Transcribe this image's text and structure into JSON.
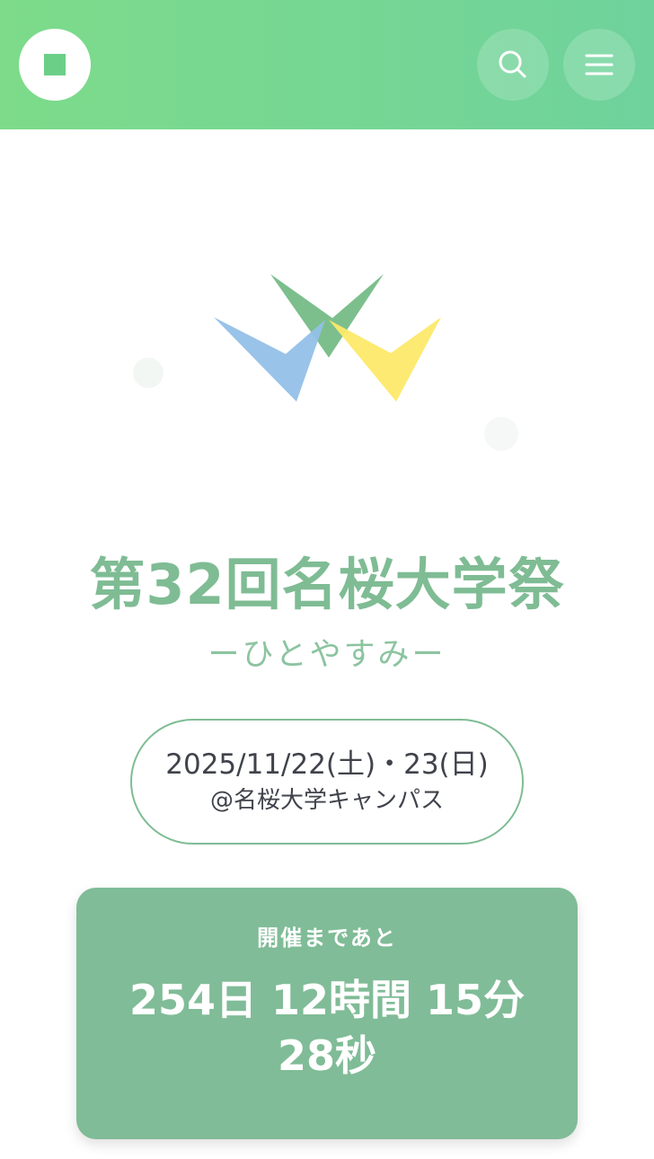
{
  "header": {
    "logo_icon": "square-logo-icon",
    "search_icon": "search-icon",
    "menu_icon": "hamburger-menu-icon"
  },
  "hero": {
    "title": "第32回名桜大学祭",
    "subtitle": "ーひとやすみー"
  },
  "event": {
    "date": "2025/11/22(土)・23(日)",
    "place": "@名桜大学キャンパス"
  },
  "countdown": {
    "label": "開催まであと",
    "line1": "254日 12時間 15分",
    "line2": "28秒"
  },
  "colors": {
    "header_start": "#7ddb8a",
    "header_end": "#6fd29c",
    "accent_green": "#7fbc94",
    "logo_blue": "#94c0e8",
    "logo_yellow": "#fde96a",
    "logo_green": "#7cbf8c"
  }
}
